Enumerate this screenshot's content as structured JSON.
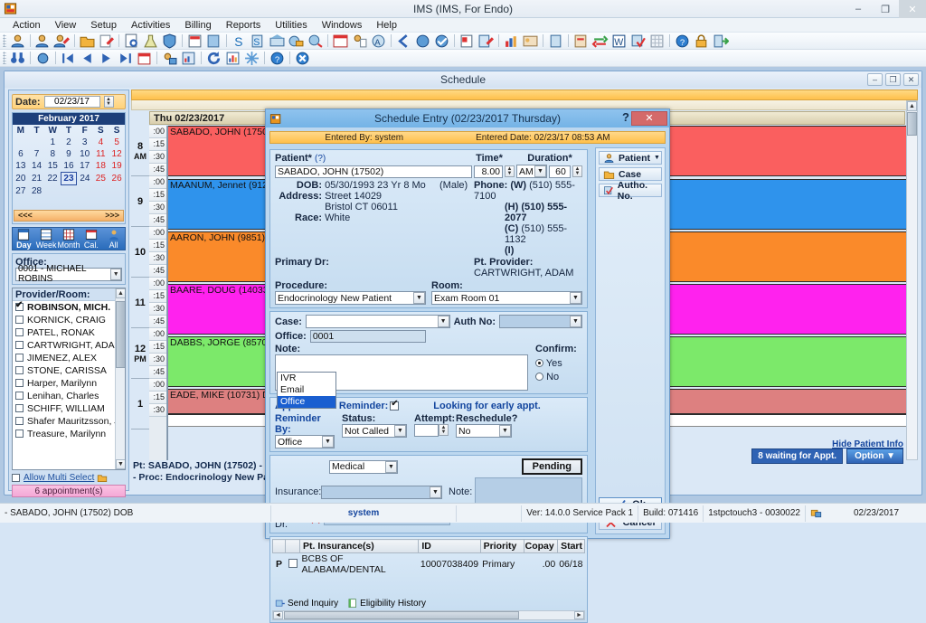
{
  "window": {
    "title": "IMS (IMS, For Endo)",
    "minimize": "–",
    "maximize": "❐",
    "close": "✕"
  },
  "menubar": [
    "Action",
    "View",
    "Setup",
    "Activities",
    "Billing",
    "Reports",
    "Utilities",
    "Windows",
    "Help"
  ],
  "child_window": {
    "title": "Schedule",
    "buttons": [
      "–",
      "❐",
      "✕"
    ]
  },
  "left_pane": {
    "date_label": "Date:",
    "date_value": "02/23/17",
    "calendar": {
      "month_title": "February 2017",
      "weekdays": [
        "M",
        "T",
        "W",
        "T",
        "F",
        "S",
        "S"
      ],
      "selected_day": "23",
      "weeks": [
        [
          "",
          "",
          "1",
          "2",
          "3",
          "4",
          "5"
        ],
        [
          "6",
          "7",
          "8",
          "9",
          "10",
          "11",
          "12"
        ],
        [
          "13",
          "14",
          "15",
          "16",
          "17",
          "18",
          "19"
        ],
        [
          "20",
          "21",
          "22",
          "23",
          "24",
          "25",
          "26"
        ],
        [
          "27",
          "28",
          "",
          "",
          "",
          "",
          ""
        ],
        [
          "",
          "",
          "",
          "",
          "",
          "",
          ""
        ]
      ],
      "nav": [
        "<<",
        "<",
        ">",
        ">>"
      ]
    },
    "view_tabs": [
      {
        "label": "Day",
        "icon": "day-view-icon",
        "active": true
      },
      {
        "label": "Week",
        "icon": "week-view-icon",
        "active": false
      },
      {
        "label": "Month",
        "icon": "month-view-icon",
        "active": false
      },
      {
        "label": "Cal.",
        "icon": "calendar-view-icon",
        "active": false
      },
      {
        "label": "All",
        "icon": "all-view-icon",
        "active": false
      }
    ],
    "office_label": "Office:",
    "office_value": "0001 - MICHAEL ROBINS",
    "provider_header": "Provider/Room:",
    "providers": [
      {
        "name": "ROBINSON, MICH.",
        "checked": true
      },
      {
        "name": "KORNICK, CRAIG",
        "checked": false
      },
      {
        "name": "PATEL, RONAK",
        "checked": false
      },
      {
        "name": "CARTWRIGHT, ADAM",
        "checked": false
      },
      {
        "name": "JIMENEZ, ALEX",
        "checked": false
      },
      {
        "name": "STONE, CARISSA",
        "checked": false
      },
      {
        "name": "Harper, Marilynn",
        "checked": false
      },
      {
        "name": "Lenihan, Charles",
        "checked": false
      },
      {
        "name": "SCHIFF, WILLIAM",
        "checked": false
      },
      {
        "name": "Shafer Mauritzsson, Ja",
        "checked": false
      },
      {
        "name": "Treasure, Marilynn",
        "checked": false
      }
    ],
    "allow_multi_select": "Allow Multi Select",
    "appointment_count": "6 appointment(s)"
  },
  "schedule": {
    "day_header": "Thu 02/23/2017",
    "hours": [
      {
        "hour": "8",
        "ampm": "AM"
      },
      {
        "hour": "9",
        "ampm": ""
      },
      {
        "hour": "10",
        "ampm": ""
      },
      {
        "hour": "11",
        "ampm": ""
      },
      {
        "hour": "12",
        "ampm": "PM"
      },
      {
        "hour": "1",
        "ampm": ""
      }
    ],
    "quarters": [
      ":00",
      ":15",
      ":30",
      ":45"
    ],
    "appointments": [
      {
        "text": "SABADO, JOHN  (17502)  DOB:",
        "color": "#fa5f5f"
      },
      {
        "text": "MAANUM, Jennet  (9128)  DO",
        "color": "#2f93ec"
      },
      {
        "text": "AARON, JOHN  (9851)  DOB",
        "color": "#fa8a2a"
      },
      {
        "text": "BAARE, DOUG  (14033)  DO",
        "color": "#ff22ee"
      },
      {
        "text": "DABBS, JORGE  (8570)  DO",
        "color": "#7ce96a"
      },
      {
        "text": "EADE, MIKE  (10731)  DOB:",
        "color": "#dd8080"
      }
    ],
    "footer_line1": "Pt: SABADO, JOHN  (17502) - DOB: ",
    "footer_line2": "- Proc: Endocrinology New Patient - ",
    "hide_patient_info": "Hide Patient Info",
    "waiting_button": "8 waiting for Appt.",
    "option_button": "Option"
  },
  "dialog": {
    "title": "Schedule Entry (02/23/2017 Thursday)",
    "help_glyph": "?",
    "close_glyph": "✕",
    "entered_by_label": "Entered By:",
    "entered_by_value": "system",
    "entered_date_label": "Entered Date:",
    "entered_date_value": "02/23/17 08:53 AM",
    "patient_label": "Patient*",
    "patient_hint": "(?)",
    "patient_value": "SABADO, JOHN  (17502)",
    "time_label": "Time*",
    "time_value": "8.00",
    "ampm_value": "AM",
    "duration_label": "Duration*",
    "duration_value": "60",
    "dob_label": "DOB:",
    "dob_value": "05/30/1993 23 Yr 8 Mo",
    "gender": "(Male)",
    "phone_label": "Phone:",
    "phone_w_label": "(W)",
    "phone_w": "(510) 555-7100",
    "phone_h_label": "(H)",
    "phone_h": "(510) 555-2077",
    "phone_c_label": "(C)",
    "phone_c": "(510) 555-1132",
    "phone_i_label": "(I)",
    "phone_i": "",
    "address_label": "Address:",
    "address_line1": "Street 14029",
    "address_line2": "Bristol  CT  06011",
    "race_label": "Race:",
    "race_value": "White",
    "primary_dr_label": "Primary Dr:",
    "primary_dr_value": "",
    "pt_provider_label": "Pt. Provider:",
    "pt_provider_value": "CARTWRIGHT, ADAM",
    "procedure_label": "Procedure:",
    "procedure_value": "Endocrinology New Patient",
    "room_label": "Room:",
    "room_value": "Exam Room 01",
    "case_label": "Case:",
    "case_value": "",
    "auth_no_label": "Auth No:",
    "auth_no_value": "",
    "office_label": "Office:",
    "office_value": "0001",
    "note_label": "Note:",
    "note_value": "",
    "confirm_label": "Confirm:",
    "confirm_yes": "Yes",
    "confirm_no": "No",
    "confirm_selected": "Yes",
    "appointment_reminder_label": "Appointment Reminder:",
    "appointment_reminder_checked": true,
    "looking_early": "Looking for early appt.",
    "reminder_by_label": "Reminder By:",
    "reminder_by_value": "Office",
    "reminder_by_options": [
      "IVR",
      "Email",
      "Office"
    ],
    "reminder_by_selected_option": "Office",
    "status_label": "Status:",
    "status_value": "Not Called",
    "attempt_label": "Attempt:",
    "attempt_value": "",
    "reschedule_label": "Reschedule?",
    "reschedule_value": "No",
    "type_value": "Medical",
    "pending_button": "Pending",
    "insurance_label": "Insurance:",
    "insurance_value": "",
    "note2_label": "Note:",
    "note2_value": "",
    "ref_dr_label": "Ref. Dr.",
    "ref_dr_hint": "(?)",
    "ref_dr_value": "",
    "ins_table": {
      "columns": [
        "",
        "",
        "Pt. Insurance(s)",
        "ID",
        "Priority",
        "Copay",
        "Start"
      ],
      "rows": [
        {
          "flag": "P",
          "checked": false,
          "name": "BCBS OF ALABAMA/DENTAL",
          "id": "10007038409",
          "priority": "Primary",
          "copay": ".00",
          "start": "06/18"
        }
      ]
    },
    "send_inquiry": "Send Inquiry",
    "eligibility_history": "Eligibility History",
    "side_buttons": [
      {
        "label": "Patient",
        "icon": "patient-icon",
        "dropdown": true
      },
      {
        "label": "Case",
        "icon": "case-folder-icon",
        "dropdown": false
      },
      {
        "label": "Autho. No.",
        "icon": "autho-icon",
        "dropdown": false
      }
    ],
    "ok_button": "Ok",
    "cancel_button": "Cancel"
  },
  "statusbar": {
    "patient": "- SABADO, JOHN  (17502) DOB",
    "user": "system",
    "blank": "",
    "version": "Ver: 14.0.0 Service Pack 1",
    "build": "Build: 071416",
    "machine": "1stpctouch3 - 0030022",
    "date": "02/23/2017"
  },
  "colors": {
    "accent": "#2f63b4",
    "dialog_title": "#74b3e6",
    "gold": "#ffc04b",
    "link": "#14459e"
  }
}
